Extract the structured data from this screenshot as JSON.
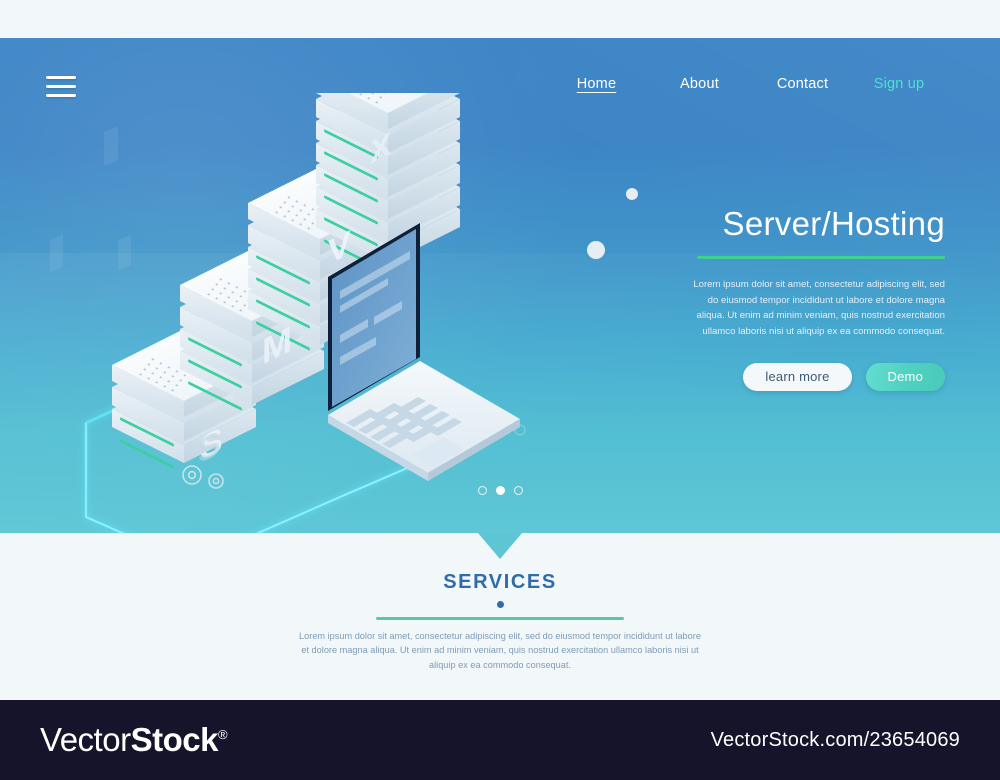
{
  "nav": {
    "menu_icon": "hamburger-icon",
    "items": [
      {
        "label": "Home",
        "active": true
      },
      {
        "label": "About",
        "active": false
      },
      {
        "label": "Contact",
        "active": false
      },
      {
        "label": "Sign up",
        "active": false
      }
    ]
  },
  "hero": {
    "title": "Server/Hosting",
    "paragraph": "Lorem ipsum dolor sit amet, consectetur adipiscing elit, sed do eiusmod tempor incididunt ut labore et dolore magna aliqua. Ut enim ad minim veniam, quis nostrud exercitation ullamco laboris nisi ut aliquip ex ea commodo consequat.",
    "primary_button": "learn more",
    "secondary_button": "Demo",
    "accent_rule_color": "#3ed18f",
    "gradient_top": "#3d85c6",
    "gradient_bottom": "#5fc7d6"
  },
  "carousel": {
    "slides": 3,
    "active_index": 1
  },
  "services": {
    "title": "SERVICES",
    "paragraph": "Lorem ipsum dolor sit amet, consectetur adipiscing elit, sed do eiusmod tempor incididunt ut labore et dolore magna aliqua. Ut enim ad minim veniam, quis nostrud exercitation ullamco laboris nisi ut aliquip ex ea commodo consequat.",
    "title_color": "#2f6ca9",
    "rule_color": "#57c9a5"
  },
  "illustration": {
    "description": "isometric server racks, laptop and circuit",
    "stack_heights": [
      2,
      3,
      4,
      6
    ],
    "floating_letters": [
      "S",
      "M",
      "V",
      "X"
    ],
    "glow_color": "#5fe4f5"
  },
  "footer": {
    "logo_part1": "Vector",
    "logo_part2": "Stock",
    "logo_registered": "®",
    "url": "VectorStock.com/23654069",
    "background": "#15142b"
  }
}
